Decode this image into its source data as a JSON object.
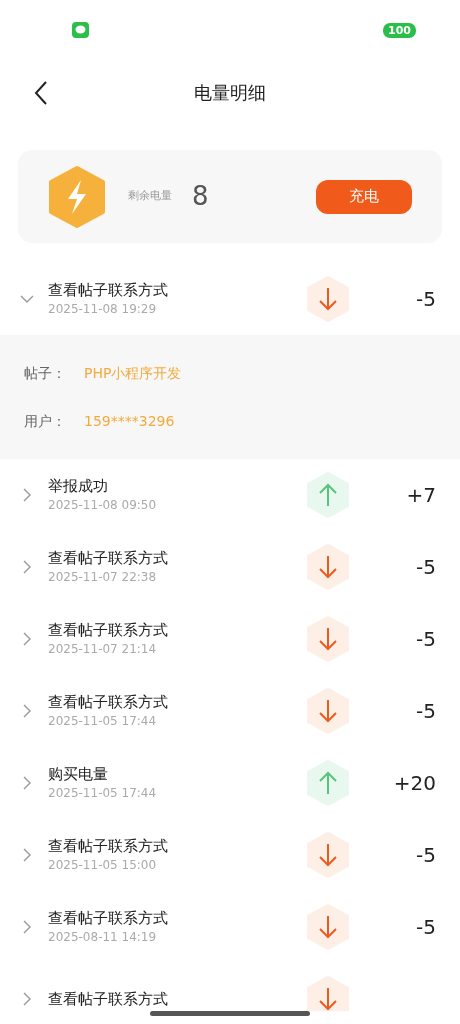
{
  "status_bar": {
    "battery": "100"
  },
  "header": {
    "title": "电量明细"
  },
  "balance": {
    "label": "剩余电量",
    "value": "8",
    "button": "充电"
  },
  "records": [
    {
      "title": "查看帖子联系方式",
      "time": "2025-11-08 19:29",
      "kind": "down",
      "amount": "-5",
      "expanded": true,
      "details": [
        {
          "label": "帖子：",
          "value": "PHP小程序开发"
        },
        {
          "label": "用户：",
          "value": "159****3296"
        }
      ]
    },
    {
      "title": "举报成功",
      "time": "2025-11-08 09:50",
      "kind": "up",
      "amount": "+7",
      "expanded": false
    },
    {
      "title": "查看帖子联系方式",
      "time": "2025-11-07 22:38",
      "kind": "down",
      "amount": "-5",
      "expanded": false
    },
    {
      "title": "查看帖子联系方式",
      "time": "2025-11-07 21:14",
      "kind": "down",
      "amount": "-5",
      "expanded": false
    },
    {
      "title": "查看帖子联系方式",
      "time": "2025-11-05 17:44",
      "kind": "down",
      "amount": "-5",
      "expanded": false
    },
    {
      "title": "购买电量",
      "time": "2025-11-05 17:44",
      "kind": "up",
      "amount": "+20",
      "expanded": false
    },
    {
      "title": "查看帖子联系方式",
      "time": "2025-11-05 15:00",
      "kind": "down",
      "amount": "-5",
      "expanded": false
    },
    {
      "title": "查看帖子联系方式",
      "time": "2025-08-11 14:19",
      "kind": "down",
      "amount": "-5",
      "expanded": false
    },
    {
      "title": "查看帖子联系方式",
      "kind": "down",
      "expanded": false
    }
  ]
}
